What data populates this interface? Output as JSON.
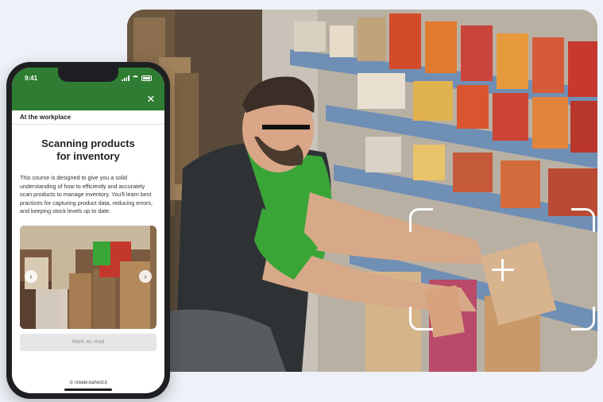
{
  "phone": {
    "status_bar": {
      "time": "9:41"
    },
    "header": {
      "close_icon": "close-icon"
    },
    "section_label": "At the workplace",
    "course": {
      "title_line1": "Scanning products",
      "title_line2": "for inventory",
      "description": "This course is designed to give you a solid understanding of how to efficiently and accurately scan products to manage inventory. You'll learn best practices for capturing product data, reducing errors, and keeping stock levels up to date."
    },
    "carousel": {
      "prev_icon": "chevron-left-icon",
      "next_icon": "chevron-right-icon",
      "prev_glyph": "‹",
      "next_glyph": "›"
    },
    "mark_button_label": "Mark as read",
    "footer_url": "⊙ create.kahoot.it"
  },
  "colors": {
    "brand_green": "#2e7d32",
    "background": "#eef2f8",
    "shirt_green": "#3aa537"
  }
}
